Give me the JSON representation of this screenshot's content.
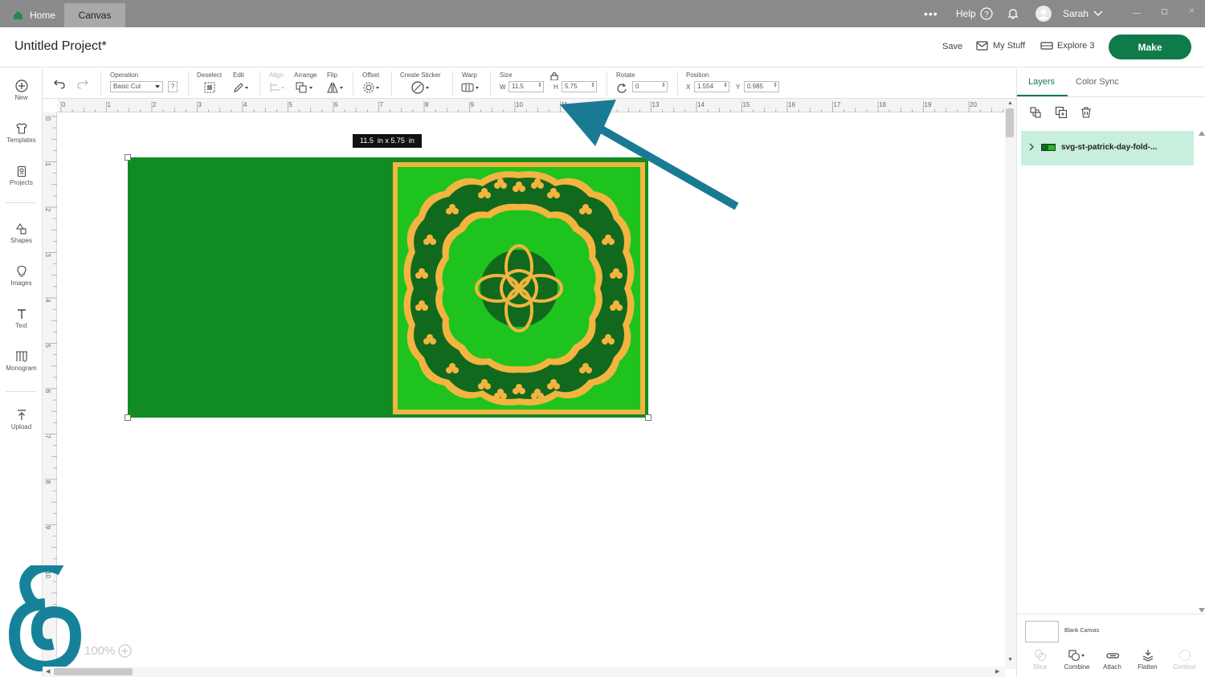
{
  "topbar": {
    "tabs": [
      {
        "label": "Home"
      },
      {
        "label": "Canvas"
      }
    ],
    "help_label": "Help",
    "user_name": "Sarah"
  },
  "header": {
    "project_title": "Untitled Project*",
    "save_label": "Save",
    "mystuff_label": "My Stuff",
    "machine_label": "Explore 3",
    "make_label": "Make"
  },
  "toolbar": {
    "operation_label": "Operation",
    "operation_value": "Basic Cut",
    "operation_help": "?",
    "deselect_label": "Deselect",
    "edit_label": "Edit",
    "align_label": "Align",
    "arrange_label": "Arrange",
    "flip_label": "Flip",
    "offset_label": "Offset",
    "sticker_label": "Create Sticker",
    "warp_label": "Warp",
    "size_label": "Size",
    "w_label": "W",
    "w_value": "11.5",
    "h_label": "H",
    "h_value": "5.75",
    "rotate_label": "Rotate",
    "rotate_value": "0",
    "position_label": "Position",
    "x_label": "X",
    "x_value": "1.554",
    "y_label": "Y",
    "y_value": "0.985"
  },
  "sidebar": {
    "items": [
      {
        "label": "New"
      },
      {
        "label": "Templates"
      },
      {
        "label": "Projects"
      },
      {
        "label": "Shapes"
      },
      {
        "label": "Images"
      },
      {
        "label": "Text"
      },
      {
        "label": "Monogram"
      },
      {
        "label": "Upload"
      }
    ]
  },
  "ruler": {
    "h_ticks": [
      "0",
      "1",
      "2",
      "3",
      "4",
      "5",
      "6",
      "7",
      "8",
      "9",
      "10",
      "11",
      "12",
      "13",
      "14",
      "15",
      "16",
      "17",
      "18",
      "19",
      "20"
    ],
    "v_ticks": [
      "0",
      "1",
      "2",
      "3",
      "4",
      "5",
      "6",
      "7",
      "8",
      "9",
      "10"
    ]
  },
  "canvas": {
    "size_tooltip": "11.5  in x 5.75  in",
    "zoom": "100%"
  },
  "colors": {
    "brand_green": "#0f7a4a",
    "card_green": "#118c23",
    "bright_green": "#1ec31e",
    "gold": "#f3b440",
    "arrow_teal": "#1a7a94"
  },
  "layers_panel": {
    "tabs": [
      {
        "label": "Layers"
      },
      {
        "label": "Color Sync"
      }
    ],
    "layer_name": "svg-st-patrick-day-fold-...",
    "blank_canvas_label": "Blank Canvas",
    "bottom_tools": [
      {
        "label": "Slice"
      },
      {
        "label": "Combine"
      },
      {
        "label": "Attach"
      },
      {
        "label": "Flatten"
      },
      {
        "label": "Contour"
      }
    ]
  }
}
